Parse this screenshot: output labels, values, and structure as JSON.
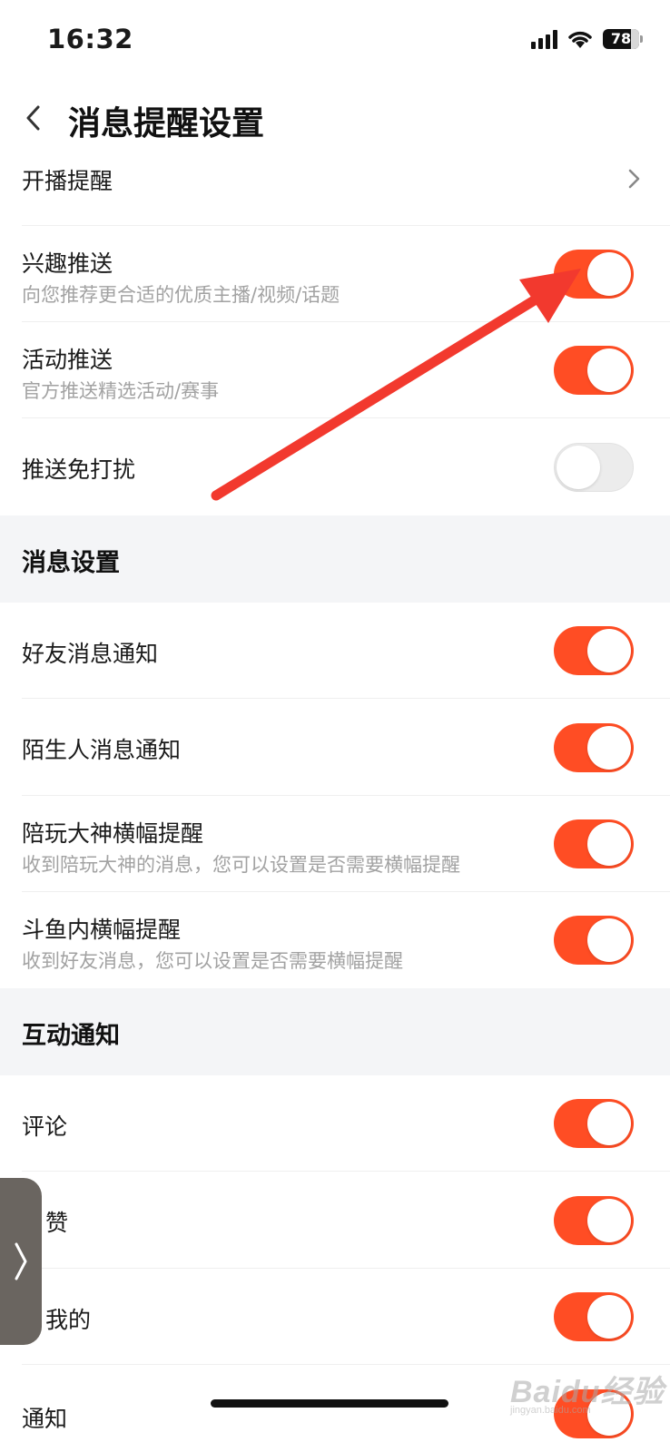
{
  "status_bar": {
    "time": "16:32",
    "battery": "78"
  },
  "header": {
    "title": "消息提醒设置"
  },
  "rows_top": [
    {
      "title": "开播提醒",
      "type": "link"
    },
    {
      "title": "兴趣推送",
      "subtitle": "向您推荐更合适的优质主播/视频/话题",
      "toggle": "on"
    },
    {
      "title": "活动推送",
      "subtitle": "官方推送精选活动/赛事",
      "toggle": "on"
    },
    {
      "title": "推送免打扰",
      "toggle": "off"
    }
  ],
  "section_message": {
    "title": "消息设置",
    "rows": [
      {
        "title": "好友消息通知",
        "toggle": "on"
      },
      {
        "title": "陌生人消息通知",
        "toggle": "on"
      },
      {
        "title": "陪玩大神横幅提醒",
        "subtitle": "收到陪玩大神的消息，您可以设置是否需要横幅提醒",
        "toggle": "on"
      },
      {
        "title": "斗鱼内横幅提醒",
        "subtitle": "收到好友消息，您可以设置是否需要横幅提醒",
        "toggle": "on"
      }
    ]
  },
  "section_interaction": {
    "title": "互动通知",
    "rows": [
      {
        "title": "评论",
        "toggle": "on"
      },
      {
        "title": "赞",
        "toggle": "on"
      },
      {
        "title": "我的",
        "toggle": "on"
      },
      {
        "title": "通知",
        "toggle": "on"
      }
    ]
  },
  "watermark": {
    "text": "Baidu经验",
    "sub": "jingyan.baidu.com"
  },
  "colors": {
    "accent": "#ff4d24",
    "annotation_arrow": "#f2392e",
    "section_bg": "#f4f5f7"
  },
  "icons": {
    "back": "chevron-left-icon",
    "row_link": "chevron-right-icon",
    "side_tab": "chevron-right-icon"
  }
}
